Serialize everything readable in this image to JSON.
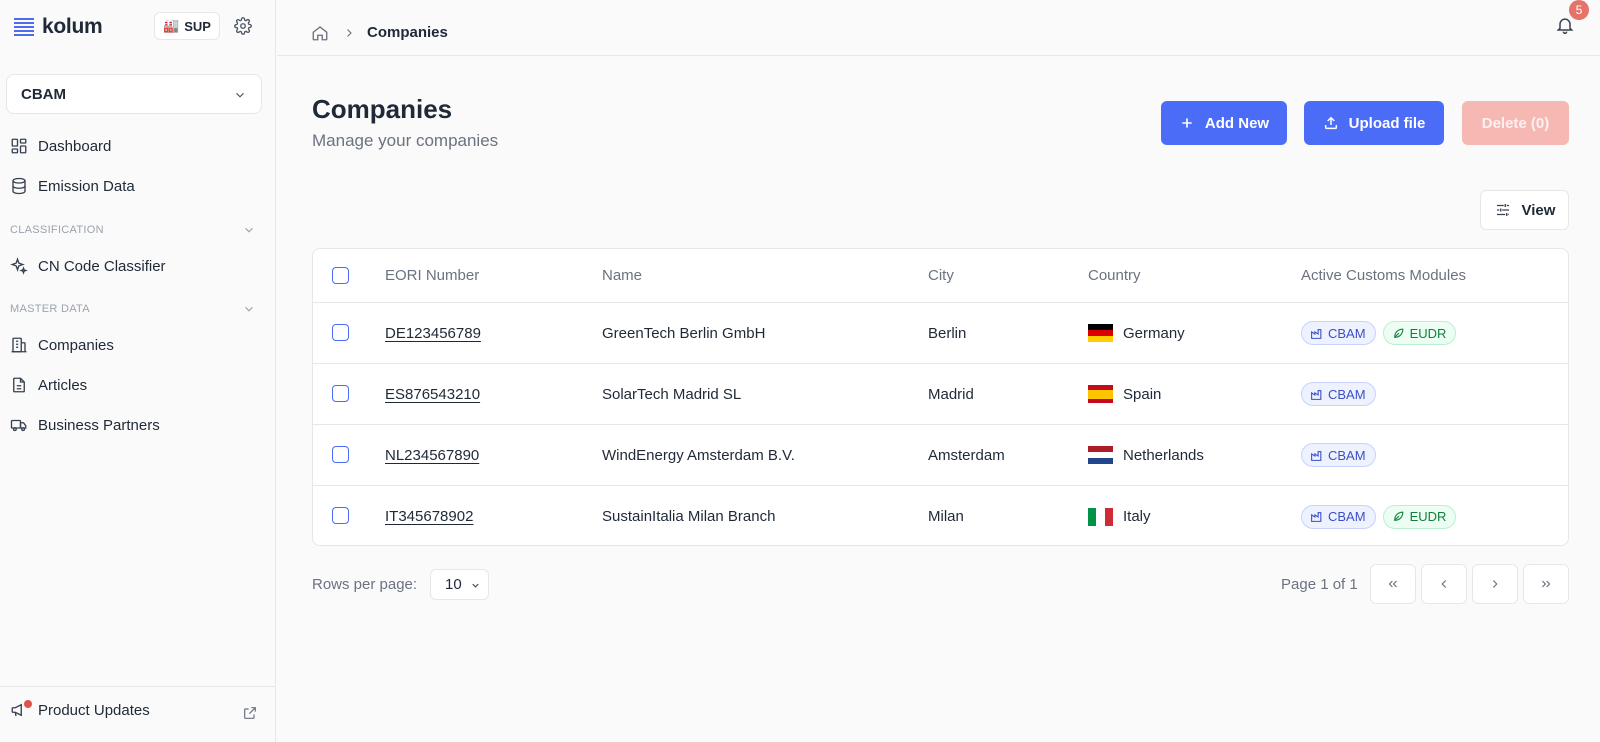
{
  "app": {
    "name": "kolum",
    "org_badge": "SUP"
  },
  "sidebar": {
    "module_select": "CBAM",
    "top_items": [
      {
        "label": "Dashboard",
        "icon": "dashboard-icon"
      },
      {
        "label": "Emission Data",
        "icon": "database-icon"
      }
    ],
    "sections": [
      {
        "title": "CLASSIFICATION",
        "items": [
          {
            "label": "CN Code Classifier",
            "icon": "sparkles-icon"
          }
        ]
      },
      {
        "title": "MASTER DATA",
        "items": [
          {
            "label": "Companies",
            "icon": "building-icon"
          },
          {
            "label": "Articles",
            "icon": "document-icon"
          },
          {
            "label": "Business Partners",
            "icon": "truck-icon"
          }
        ]
      }
    ],
    "footer": {
      "label": "Product Updates"
    }
  },
  "topbar": {
    "breadcrumb_current": "Companies",
    "notifications_count": "5"
  },
  "page": {
    "title": "Companies",
    "subtitle": "Manage your companies",
    "add_label": "Add New",
    "upload_label": "Upload file",
    "delete_label": "Delete (0)",
    "view_label": "View"
  },
  "table": {
    "columns": [
      "EORI Number",
      "Name",
      "City",
      "Country",
      "Active Customs Modules"
    ],
    "rows": [
      {
        "eori": "DE123456789",
        "name": "GreenTech Berlin GmbH",
        "city": "Berlin",
        "country": "Germany",
        "modules": [
          "CBAM",
          "EUDR"
        ]
      },
      {
        "eori": "ES876543210",
        "name": "SolarTech Madrid SL",
        "city": "Madrid",
        "country": "Spain",
        "modules": [
          "CBAM"
        ]
      },
      {
        "eori": "NL234567890",
        "name": "WindEnergy Amsterdam B.V.",
        "city": "Amsterdam",
        "country": "Netherlands",
        "modules": [
          "CBAM"
        ]
      },
      {
        "eori": "IT345678902",
        "name": "SustainItalia Milan Branch",
        "city": "Milan",
        "country": "Italy",
        "modules": [
          "CBAM",
          "EUDR"
        ]
      }
    ]
  },
  "pagination": {
    "rows_per_page_label": "Rows per page:",
    "rows_per_page_value": "10",
    "page_info": "Page 1 of 1"
  },
  "colors": {
    "primary": "#4a6cf7",
    "danger_disabled": "#f5b8b3",
    "badge": "#e5736a"
  }
}
